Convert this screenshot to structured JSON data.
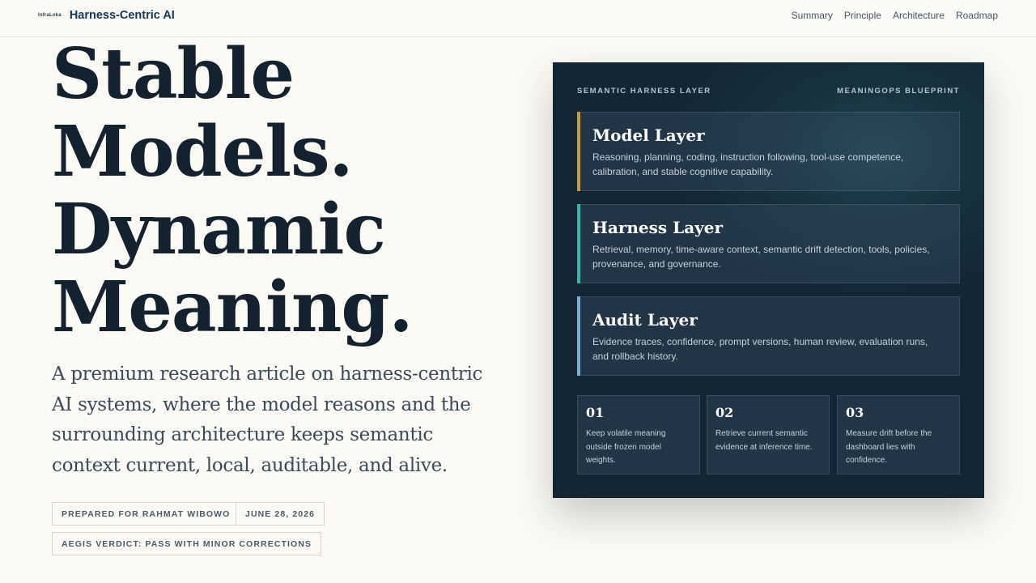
{
  "header": {
    "logo_text": "InfraLoka",
    "brand_title": "Harness-Centric AI",
    "nav": [
      "Summary",
      "Principle",
      "Architecture",
      "Roadmap"
    ]
  },
  "hero": {
    "headline": [
      "Stable",
      "Models.",
      "Dynamic",
      "Meaning."
    ],
    "lede": "A premium research article on harness-centric AI systems, where the model reasons and the surrounding architecture keeps semantic context current, local, auditable, and alive.",
    "chips": [
      "PREPARED FOR RAHMAT WIBOWO",
      "JUNE 28, 2026",
      "AEGIS VERDICT: PASS WITH MINOR CORRECTIONS"
    ]
  },
  "panel": {
    "left_label": "SEMANTIC HARNESS LAYER",
    "right_label": "MEANINGOPS BLUEPRINT",
    "layers": [
      {
        "title": "Model Layer",
        "description": "Reasoning, planning, coding, instruction following, tool-use competence, calibration, and stable cognitive capability.",
        "accent": "#c89a3c"
      },
      {
        "title": "Harness Layer",
        "description": "Retrieval, memory, time-aware context, semantic drift detection, tools, policies, provenance, and governance.",
        "accent": "#2fb7a6"
      },
      {
        "title": "Audit Layer",
        "description": "Evidence traces, confidence, prompt versions, human review, evaluation runs, and rollback history.",
        "accent": "#7ab1cf"
      }
    ],
    "steps": [
      {
        "number": "01",
        "text": "Keep volatile meaning outside frozen model weights."
      },
      {
        "number": "02",
        "text": "Retrieve current semantic evidence at inference time."
      },
      {
        "number": "03",
        "text": "Measure drift before the dashboard lies with confidence."
      }
    ]
  },
  "colors": {
    "background": "#fcfaf5",
    "ink": "#13222e",
    "brand": "#14385a",
    "panel": "#142636"
  }
}
